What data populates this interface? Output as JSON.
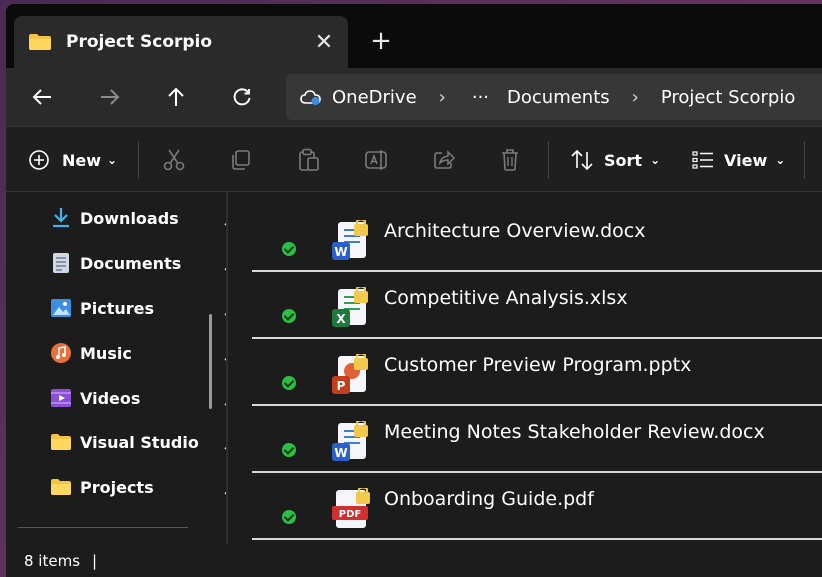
{
  "tab": {
    "title": "Project Scorpio",
    "close": "✕",
    "new_tab": "+"
  },
  "nav": {
    "back": "←",
    "forward": "→",
    "up": "↑",
    "refresh": "⟳"
  },
  "address": {
    "root": "OneDrive",
    "sep": "›",
    "more": "···",
    "crumbs": [
      "Documents",
      "Project Scorpio"
    ]
  },
  "toolbar": {
    "new_label": "New",
    "sort_label": "Sort",
    "view_label": "View",
    "chevron": "⌄"
  },
  "sidebar": {
    "items": [
      {
        "label": "Downloads",
        "icon": "download-icon"
      },
      {
        "label": "Documents",
        "icon": "document-icon"
      },
      {
        "label": "Pictures",
        "icon": "pictures-icon"
      },
      {
        "label": "Music",
        "icon": "music-icon"
      },
      {
        "label": "Videos",
        "icon": "videos-icon"
      },
      {
        "label": "Visual Studio",
        "icon": "folder-icon"
      },
      {
        "label": "Projects",
        "icon": "folder-icon"
      }
    ]
  },
  "files": [
    {
      "name": "Architecture Overview.docx",
      "type": "word"
    },
    {
      "name": "Competitive Analysis.xlsx",
      "type": "excel"
    },
    {
      "name": "Customer Preview Program.pptx",
      "type": "powerpoint"
    },
    {
      "name": "Meeting Notes Stakeholder Review.docx",
      "type": "word"
    },
    {
      "name": "Onboarding Guide.pdf",
      "type": "pdf"
    }
  ],
  "file_icon_letters": {
    "word": "W",
    "excel": "X",
    "powerpoint": "P",
    "pdf": "PDF"
  },
  "status": {
    "count": "8 items",
    "sep": "|"
  },
  "colors": {
    "word": "#2b5fc9",
    "excel": "#1e7a3c",
    "powerpoint": "#c43e1c",
    "pdf": "#d32f2f",
    "synced": "#2bbf45",
    "folder": "#f5c342"
  }
}
